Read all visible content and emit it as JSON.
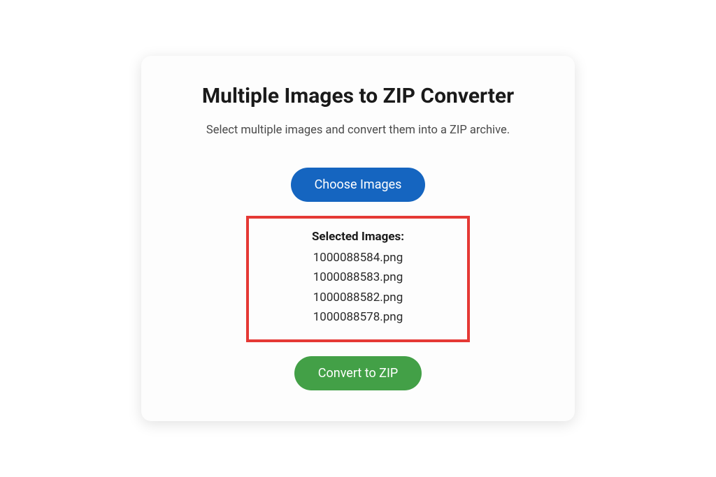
{
  "card": {
    "title": "Multiple Images to ZIP Converter",
    "subtitle": "Select multiple images and convert them into a ZIP archive.",
    "choose_button": "Choose Images",
    "convert_button": "Convert to ZIP",
    "selected_label": "Selected Images:",
    "files": [
      "1000088584.png",
      "1000088583.png",
      "1000088582.png",
      "1000088578.png"
    ]
  }
}
